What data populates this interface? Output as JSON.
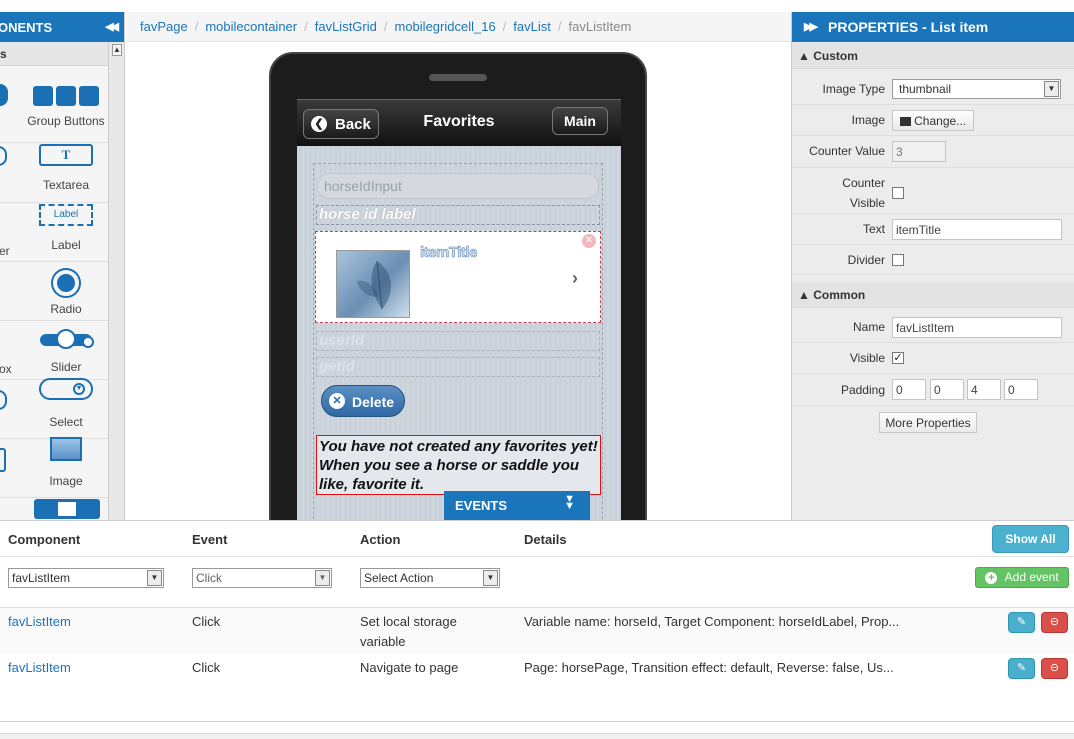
{
  "left_panel": {
    "title": "ONENTS",
    "subheader": "s",
    "items": [
      {
        "label": "Group Buttons",
        "icon": "group-buttons-icon"
      },
      {
        "label": "Textarea",
        "icon": "textarea-icon"
      },
      {
        "label": "Label",
        "icon": "label-icon",
        "icon_text": "Label"
      },
      {
        "label": "Radio",
        "icon": "radio-icon"
      },
      {
        "label": "Slider",
        "icon": "slider-icon"
      },
      {
        "label": "Select",
        "icon": "select-icon"
      },
      {
        "label": "Image",
        "icon": "image-icon"
      }
    ],
    "cut_labels": [
      "er",
      "ox"
    ]
  },
  "breadcrumb": [
    "favPage",
    "mobilecontainer",
    "favListGrid",
    "mobilegridcell_16",
    "favList",
    "favListItem"
  ],
  "mobile": {
    "back": "Back",
    "title": "Favorites",
    "main": "Main",
    "input_placeholder": "horseIdInput",
    "horse_label": "horse id label",
    "item_title": "itemTitle",
    "ghost1": "userId",
    "ghost2": "getId",
    "delete": "Delete",
    "message": "You have not created any favorites yet! When you see a horse or saddle you like, favorite it."
  },
  "events_tab": "EVENTS",
  "properties": {
    "title": "PROPERTIES - List item",
    "custom_header": "Custom",
    "image_type_label": "Image Type",
    "image_type_value": "thumbnail",
    "image_label": "Image",
    "change_button": "Change...",
    "counter_value_label": "Counter Value",
    "counter_value": "3",
    "counter_visible_label_1": "Counter",
    "counter_visible_label_2": "Visible",
    "text_label": "Text",
    "text_value": "itemTitle",
    "divider_label": "Divider",
    "common_header": "Common",
    "name_label": "Name",
    "name_value": "favListItem",
    "visible_label": "Visible",
    "visible_check": "✓",
    "padding_label": "Padding",
    "padding": [
      "0",
      "0",
      "4",
      "0"
    ],
    "more_button": "More Properties"
  },
  "events": {
    "columns": [
      "Component",
      "Event",
      "Action",
      "Details"
    ],
    "show_all": "Show All",
    "add_event": "Add event",
    "filters": {
      "component": "favListItem",
      "event": "Click",
      "action": "Select Action"
    },
    "rows": [
      {
        "component": "favListItem",
        "event": "Click",
        "action_1": "Set local storage",
        "action_2": "variable",
        "details": "Variable name: horseId, Target Component: horseIdLabel, Prop..."
      },
      {
        "component": "favListItem",
        "event": "Click",
        "action_1": "Navigate to page",
        "action_2": "",
        "details": "Page: horsePage, Transition effect: default, Reverse: false, Us..."
      }
    ]
  }
}
